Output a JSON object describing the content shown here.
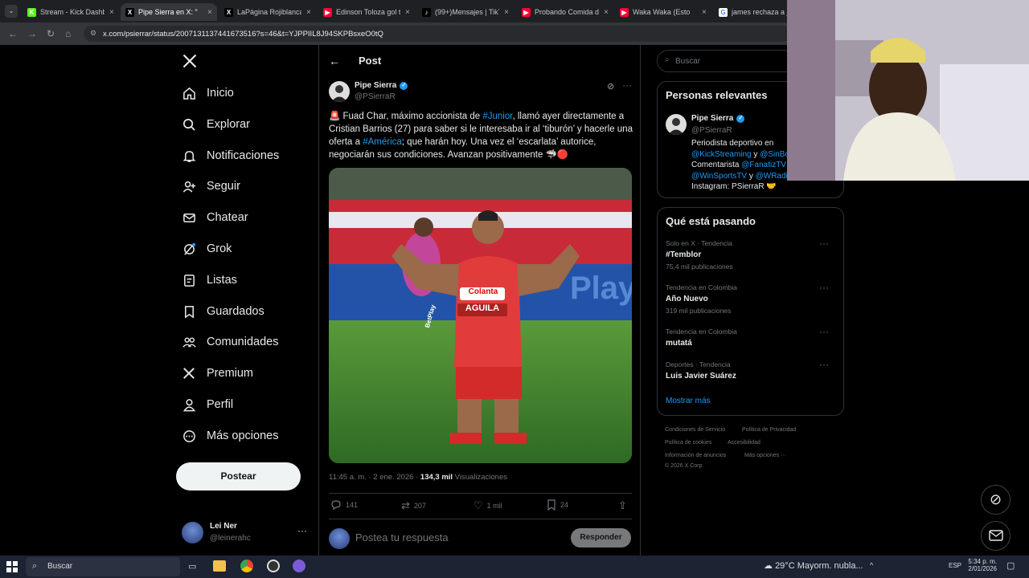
{
  "browser": {
    "tabs": [
      {
        "title": "Stream - Kick Dashbo",
        "favicon_color": "#53fc18",
        "glyph": "K",
        "active": false
      },
      {
        "title": "Pipe Sierra en X: \"",
        "favicon_color": "#000000",
        "glyph": "X",
        "active": true
      },
      {
        "title": "LaPágina Rojiblanca",
        "favicon_color": "#000000",
        "glyph": "X",
        "active": false
      },
      {
        "title": "Edinson Toloza gol te",
        "favicon_color": "#ff0033",
        "glyph": "▶",
        "active": false
      },
      {
        "title": "(99+)Mensajes | TikTo",
        "favicon_color": "#000000",
        "glyph": "♪",
        "active": false
      },
      {
        "title": "Probando Comida de",
        "favicon_color": "#ff0033",
        "glyph": "▶",
        "active": false
      },
      {
        "title": "Waka Waka (Esto",
        "favicon_color": "#ff0033",
        "glyph": "▶",
        "active": false
      },
      {
        "title": "james rechaza a jun",
        "favicon_color": "#ffffff",
        "glyph": "G",
        "active": false
      }
    ],
    "url": "x.com/psierrar/status/2007131137441673516?s=46&t=YJPPIIL8J94SKPBsxeO0tQ"
  },
  "nav": {
    "items": [
      {
        "label": "Inicio",
        "icon": "home-icon"
      },
      {
        "label": "Explorar",
        "icon": "search-icon"
      },
      {
        "label": "Notificaciones",
        "icon": "bell-icon"
      },
      {
        "label": "Seguir",
        "icon": "follow-icon"
      },
      {
        "label": "Chatear",
        "icon": "mail-icon"
      },
      {
        "label": "Grok",
        "icon": "grok-icon"
      },
      {
        "label": "Listas",
        "icon": "list-icon"
      },
      {
        "label": "Guardados",
        "icon": "bookmark-icon"
      },
      {
        "label": "Comunidades",
        "icon": "communities-icon"
      },
      {
        "label": "Premium",
        "icon": "x-logo-icon"
      },
      {
        "label": "Perfil",
        "icon": "person-icon"
      },
      {
        "label": "Más opciones",
        "icon": "more-circle-icon"
      }
    ],
    "post_button": "Postear",
    "account": {
      "name": "Lei Ner",
      "handle": "@leinerahc"
    }
  },
  "post": {
    "header_title": "Post",
    "author_name": "Pipe Sierra",
    "author_handle": "@PSierraR",
    "text_parts": [
      {
        "t": "🚨 Fuad Char, máximo accionista de ",
        "link": false
      },
      {
        "t": "#Junior",
        "link": true
      },
      {
        "t": ", llamó ayer directamente a Cristian Barrios (27) para saber si le interesaba ir al ‘tiburón’ y hacerle una oferta a ",
        "link": false
      },
      {
        "t": "#América",
        "link": true
      },
      {
        "t": "; que harán hoy. Una vez el ‘escarlata’ autorice, negociarán sus condiciones. Avanzan positivamente 🦈🔴",
        "link": false
      }
    ],
    "jersey_sponsor_1": "Colanta",
    "jersey_sponsor_2": "AGUILA",
    "jersey_sleeve": "BetPlay",
    "board_text": "Play",
    "timestamp": "11:45 a. m. · 2 ene. 2026 · ",
    "views_count": "134,3 mil",
    "views_label": " Visualizaciones",
    "replies": "141",
    "reposts": "207",
    "likes": "1 mil",
    "bookmarks": "24",
    "reply_placeholder": "Postea tu respuesta",
    "reply_button": "Responder"
  },
  "sidebar": {
    "search_placeholder": "Buscar",
    "relevant_title": "Personas relevantes",
    "relevant_name": "Pipe Sierra",
    "relevant_handle": "@PSierraR",
    "bio_line1": "Periodista deportivo en",
    "bio_l2a": "@KickStreaming",
    "bio_l2b": " y ",
    "bio_l2c": "@SinBo",
    "bio_l3a": "Comentarista ",
    "bio_l3b": "@FanatizTV",
    "bio_l4a": "@WinSportsTV",
    "bio_l4b": " y ",
    "bio_l4c": "@WRadio",
    "bio_line5": "Instagram: PSierraR 🤝",
    "trends_title": "Qué está pasando",
    "trends": [
      {
        "context": "Solo en X · Tendencia",
        "name": "#Temblor",
        "count": "75,4 mil publicaciones"
      },
      {
        "context": "Tendencia en Colombia",
        "name": "Año Nuevo",
        "count": "319 mil publicaciones"
      },
      {
        "context": "Tendencia en Colombia",
        "name": "mutatá",
        "count": ""
      },
      {
        "context": "Deportes · Tendencia",
        "name": "Luis Javier Suárez",
        "count": ""
      }
    ],
    "show_more": "Mostrar más",
    "footer": {
      "terms": "Condiciones de Servicio",
      "privacy": "Política de Privacidad",
      "cookies": "Política de cookies",
      "accessibility": "Accesibilidad",
      "ads": "Información de anuncios",
      "more": "Más opciones ···",
      "copyright": "© 2026 X Corp."
    }
  },
  "taskbar": {
    "search": "Buscar",
    "weather": "29°C  Mayorm. nubla...",
    "lang": "ESP",
    "time": "5:34 p. m.",
    "date": "2/01/2026"
  }
}
